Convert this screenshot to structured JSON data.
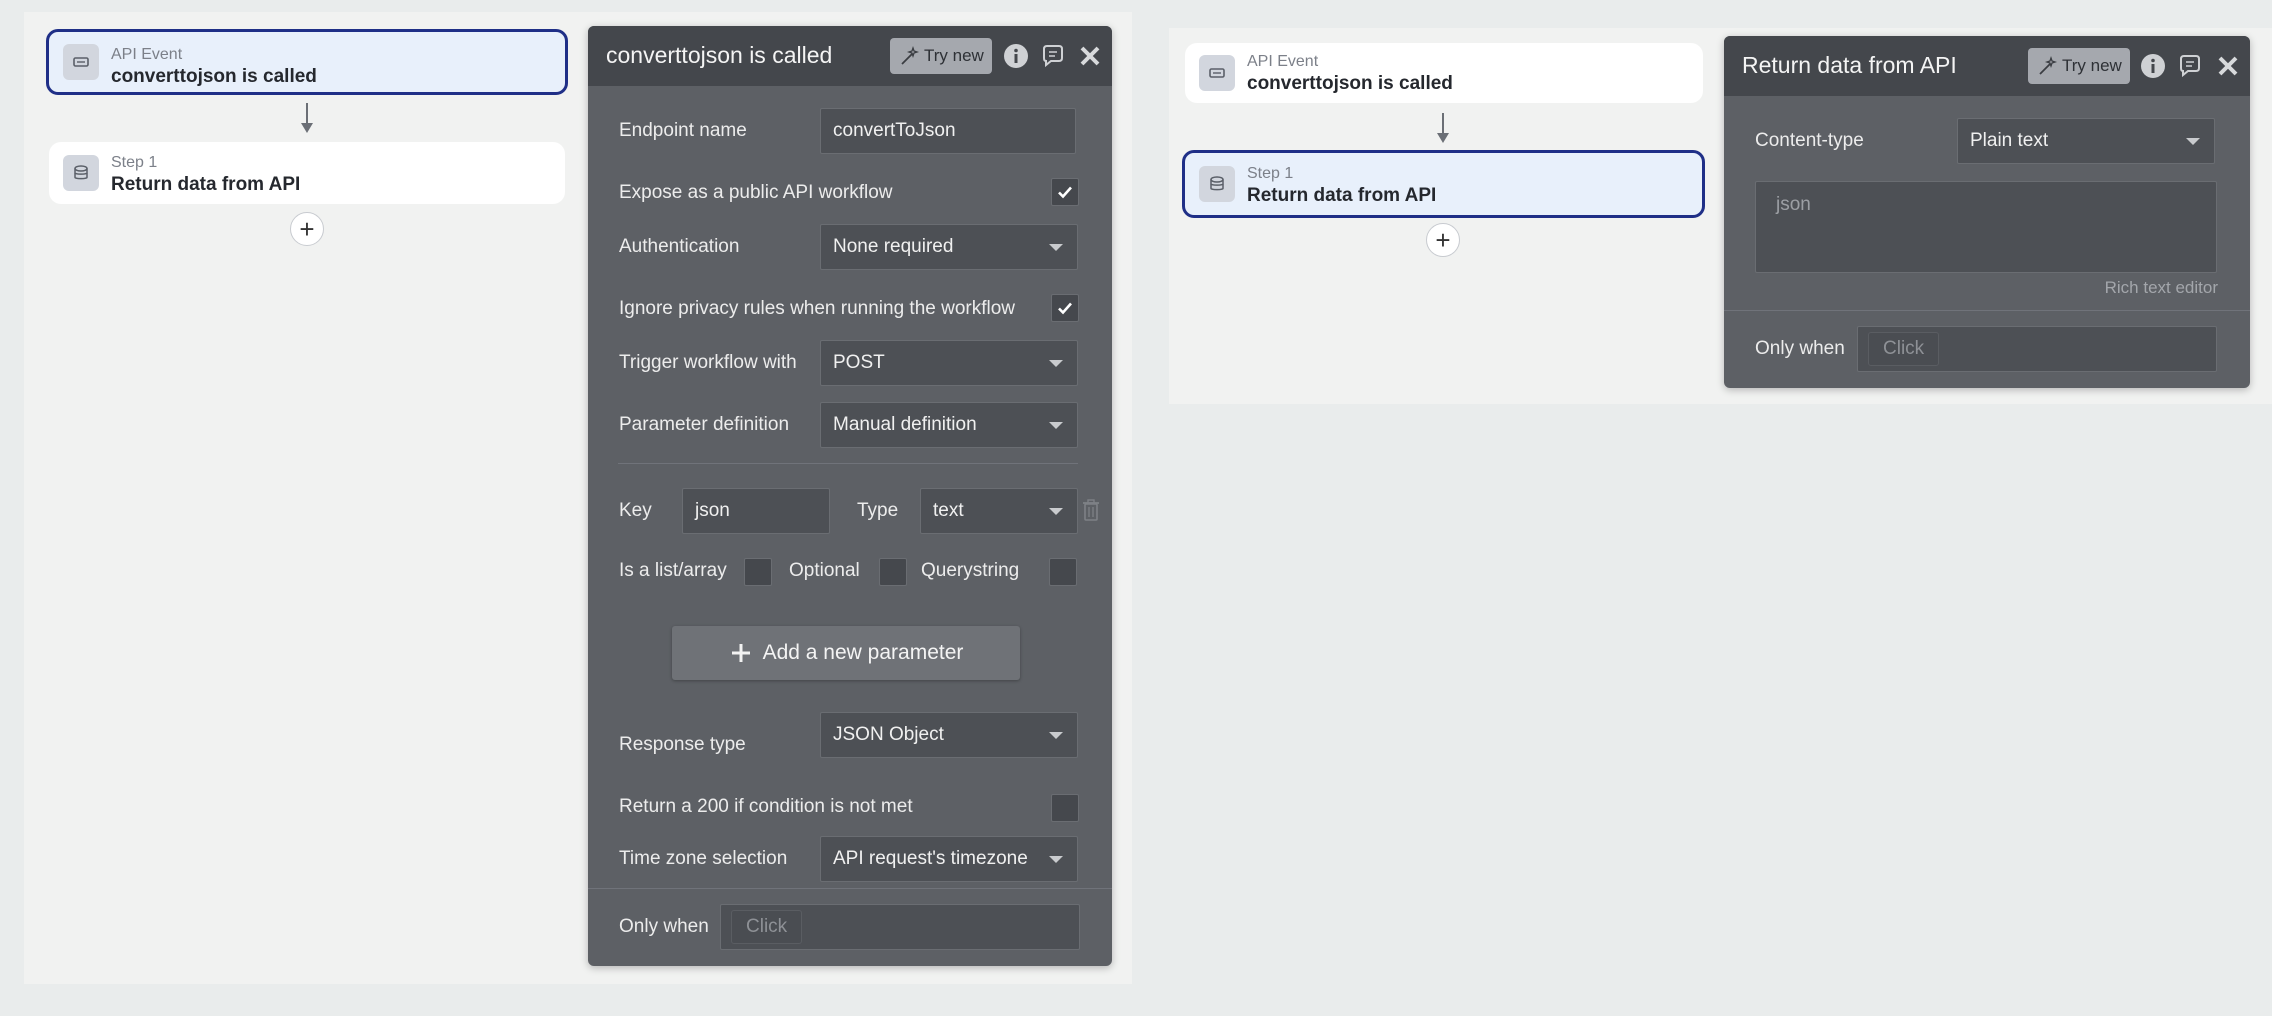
{
  "left_canvas": {
    "event_card": {
      "sub": "API Event",
      "title": "converttojson is called"
    },
    "step_card": {
      "sub": "Step 1",
      "title": "Return data from API"
    },
    "add_step": "+"
  },
  "endpoint_panel": {
    "title": "converttojson is called",
    "try_new": "Try new",
    "endpoint_name": {
      "label": "Endpoint name",
      "value": "convertToJson"
    },
    "expose_public": {
      "label": "Expose as a public API workflow",
      "checked": true
    },
    "authentication": {
      "label": "Authentication",
      "value": "None required"
    },
    "ignore_privacy": {
      "label": "Ignore privacy rules when running the workflow",
      "checked": true
    },
    "trigger": {
      "label": "Trigger workflow with",
      "value": "POST"
    },
    "param_def": {
      "label": "Parameter definition",
      "value": "Manual definition"
    },
    "param": {
      "key_label": "Key",
      "key_value": "json",
      "type_label": "Type",
      "type_value": "text",
      "is_list_label": "Is a list/array",
      "optional_label": "Optional",
      "querystring_label": "Querystring"
    },
    "add_param": "Add a new parameter",
    "response_type": {
      "label": "Response type",
      "value": "JSON Object"
    },
    "return_200": {
      "label": "Return a 200 if condition is not met",
      "checked": false
    },
    "timezone": {
      "label": "Time zone selection",
      "value": "API request's timezone"
    },
    "only_when": {
      "label": "Only when",
      "placeholder": "Click"
    }
  },
  "right_canvas": {
    "event_card": {
      "sub": "API Event",
      "title": "converttojson is called"
    },
    "step_card": {
      "sub": "Step 1",
      "title": "Return data from API"
    },
    "add_step": "+"
  },
  "return_panel": {
    "title": "Return data from API",
    "try_new": "Try new",
    "content_type": {
      "label": "Content-type",
      "value": "Plain text"
    },
    "body_value": "json",
    "rich_text": "Rich text editor",
    "only_when": {
      "label": "Only when",
      "placeholder": "Click"
    }
  },
  "colors": {
    "selected_border": "#1f2f87",
    "selected_fill": "#e8f0fb",
    "panel_bg": "#5d6065",
    "panel_header": "#44474c"
  }
}
